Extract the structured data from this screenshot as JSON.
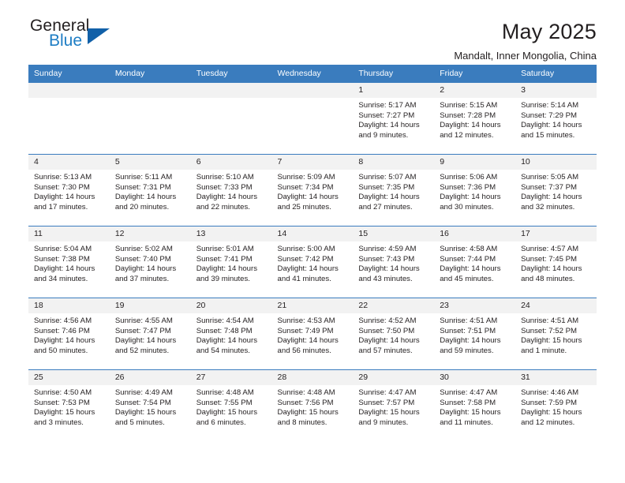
{
  "brand": {
    "line1": "General",
    "line2": "Blue",
    "triangle_color": "#1160a8",
    "blue_color": "#1d7dc4"
  },
  "header": {
    "title": "May 2025",
    "subtitle": "Mandalt, Inner Mongolia, China"
  },
  "calendar": {
    "header_bg": "#3a7cbe",
    "daynum_bg": "#f2f2f2",
    "weekday_headers": [
      "Sunday",
      "Monday",
      "Tuesday",
      "Wednesday",
      "Thursday",
      "Friday",
      "Saturday"
    ],
    "weeks": [
      [
        {
          "day": "",
          "empty": true
        },
        {
          "day": "",
          "empty": true
        },
        {
          "day": "",
          "empty": true
        },
        {
          "day": "",
          "empty": true
        },
        {
          "day": "1",
          "sunrise": "Sunrise: 5:17 AM",
          "sunset": "Sunset: 7:27 PM",
          "daylight": "Daylight: 14 hours and 9 minutes."
        },
        {
          "day": "2",
          "sunrise": "Sunrise: 5:15 AM",
          "sunset": "Sunset: 7:28 PM",
          "daylight": "Daylight: 14 hours and 12 minutes."
        },
        {
          "day": "3",
          "sunrise": "Sunrise: 5:14 AM",
          "sunset": "Sunset: 7:29 PM",
          "daylight": "Daylight: 14 hours and 15 minutes."
        }
      ],
      [
        {
          "day": "4",
          "sunrise": "Sunrise: 5:13 AM",
          "sunset": "Sunset: 7:30 PM",
          "daylight": "Daylight: 14 hours and 17 minutes."
        },
        {
          "day": "5",
          "sunrise": "Sunrise: 5:11 AM",
          "sunset": "Sunset: 7:31 PM",
          "daylight": "Daylight: 14 hours and 20 minutes."
        },
        {
          "day": "6",
          "sunrise": "Sunrise: 5:10 AM",
          "sunset": "Sunset: 7:33 PM",
          "daylight": "Daylight: 14 hours and 22 minutes."
        },
        {
          "day": "7",
          "sunrise": "Sunrise: 5:09 AM",
          "sunset": "Sunset: 7:34 PM",
          "daylight": "Daylight: 14 hours and 25 minutes."
        },
        {
          "day": "8",
          "sunrise": "Sunrise: 5:07 AM",
          "sunset": "Sunset: 7:35 PM",
          "daylight": "Daylight: 14 hours and 27 minutes."
        },
        {
          "day": "9",
          "sunrise": "Sunrise: 5:06 AM",
          "sunset": "Sunset: 7:36 PM",
          "daylight": "Daylight: 14 hours and 30 minutes."
        },
        {
          "day": "10",
          "sunrise": "Sunrise: 5:05 AM",
          "sunset": "Sunset: 7:37 PM",
          "daylight": "Daylight: 14 hours and 32 minutes."
        }
      ],
      [
        {
          "day": "11",
          "sunrise": "Sunrise: 5:04 AM",
          "sunset": "Sunset: 7:38 PM",
          "daylight": "Daylight: 14 hours and 34 minutes."
        },
        {
          "day": "12",
          "sunrise": "Sunrise: 5:02 AM",
          "sunset": "Sunset: 7:40 PM",
          "daylight": "Daylight: 14 hours and 37 minutes."
        },
        {
          "day": "13",
          "sunrise": "Sunrise: 5:01 AM",
          "sunset": "Sunset: 7:41 PM",
          "daylight": "Daylight: 14 hours and 39 minutes."
        },
        {
          "day": "14",
          "sunrise": "Sunrise: 5:00 AM",
          "sunset": "Sunset: 7:42 PM",
          "daylight": "Daylight: 14 hours and 41 minutes."
        },
        {
          "day": "15",
          "sunrise": "Sunrise: 4:59 AM",
          "sunset": "Sunset: 7:43 PM",
          "daylight": "Daylight: 14 hours and 43 minutes."
        },
        {
          "day": "16",
          "sunrise": "Sunrise: 4:58 AM",
          "sunset": "Sunset: 7:44 PM",
          "daylight": "Daylight: 14 hours and 45 minutes."
        },
        {
          "day": "17",
          "sunrise": "Sunrise: 4:57 AM",
          "sunset": "Sunset: 7:45 PM",
          "daylight": "Daylight: 14 hours and 48 minutes."
        }
      ],
      [
        {
          "day": "18",
          "sunrise": "Sunrise: 4:56 AM",
          "sunset": "Sunset: 7:46 PM",
          "daylight": "Daylight: 14 hours and 50 minutes."
        },
        {
          "day": "19",
          "sunrise": "Sunrise: 4:55 AM",
          "sunset": "Sunset: 7:47 PM",
          "daylight": "Daylight: 14 hours and 52 minutes."
        },
        {
          "day": "20",
          "sunrise": "Sunrise: 4:54 AM",
          "sunset": "Sunset: 7:48 PM",
          "daylight": "Daylight: 14 hours and 54 minutes."
        },
        {
          "day": "21",
          "sunrise": "Sunrise: 4:53 AM",
          "sunset": "Sunset: 7:49 PM",
          "daylight": "Daylight: 14 hours and 56 minutes."
        },
        {
          "day": "22",
          "sunrise": "Sunrise: 4:52 AM",
          "sunset": "Sunset: 7:50 PM",
          "daylight": "Daylight: 14 hours and 57 minutes."
        },
        {
          "day": "23",
          "sunrise": "Sunrise: 4:51 AM",
          "sunset": "Sunset: 7:51 PM",
          "daylight": "Daylight: 14 hours and 59 minutes."
        },
        {
          "day": "24",
          "sunrise": "Sunrise: 4:51 AM",
          "sunset": "Sunset: 7:52 PM",
          "daylight": "Daylight: 15 hours and 1 minute."
        }
      ],
      [
        {
          "day": "25",
          "sunrise": "Sunrise: 4:50 AM",
          "sunset": "Sunset: 7:53 PM",
          "daylight": "Daylight: 15 hours and 3 minutes."
        },
        {
          "day": "26",
          "sunrise": "Sunrise: 4:49 AM",
          "sunset": "Sunset: 7:54 PM",
          "daylight": "Daylight: 15 hours and 5 minutes."
        },
        {
          "day": "27",
          "sunrise": "Sunrise: 4:48 AM",
          "sunset": "Sunset: 7:55 PM",
          "daylight": "Daylight: 15 hours and 6 minutes."
        },
        {
          "day": "28",
          "sunrise": "Sunrise: 4:48 AM",
          "sunset": "Sunset: 7:56 PM",
          "daylight": "Daylight: 15 hours and 8 minutes."
        },
        {
          "day": "29",
          "sunrise": "Sunrise: 4:47 AM",
          "sunset": "Sunset: 7:57 PM",
          "daylight": "Daylight: 15 hours and 9 minutes."
        },
        {
          "day": "30",
          "sunrise": "Sunrise: 4:47 AM",
          "sunset": "Sunset: 7:58 PM",
          "daylight": "Daylight: 15 hours and 11 minutes."
        },
        {
          "day": "31",
          "sunrise": "Sunrise: 4:46 AM",
          "sunset": "Sunset: 7:59 PM",
          "daylight": "Daylight: 15 hours and 12 minutes."
        }
      ]
    ]
  }
}
